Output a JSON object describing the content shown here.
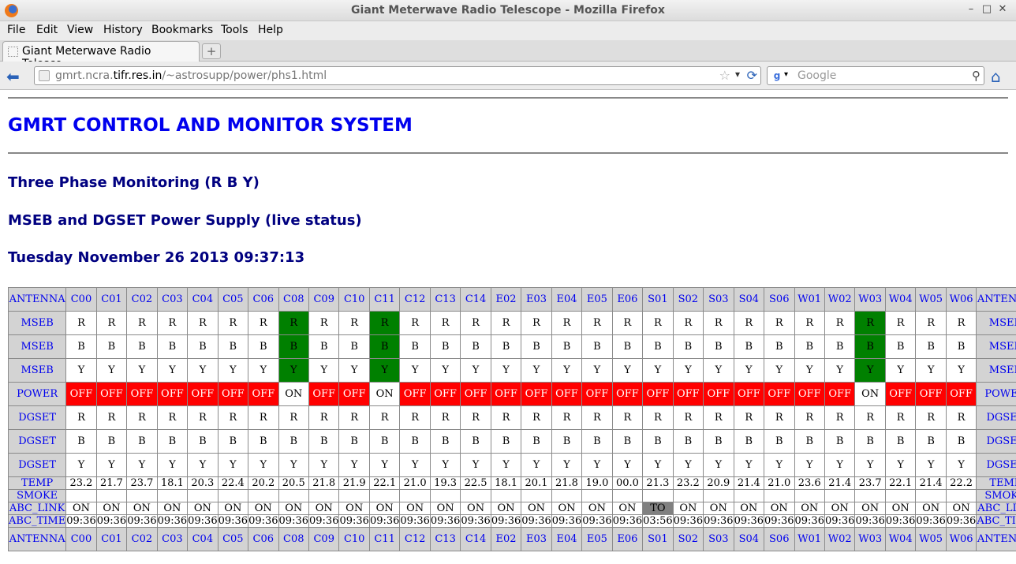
{
  "window": {
    "title": "Giant Meterwave Radio Telescope - Mozilla Firefox"
  },
  "menu": [
    "File",
    "Edit",
    "View",
    "History",
    "Bookmarks",
    "Tools",
    "Help"
  ],
  "tab": {
    "label": "Giant Meterwave Radio Telesco..."
  },
  "urlbar": {
    "prefix": "gmrt.ncra.",
    "domain": "tifr.res.in",
    "path": "/~astrosupp/power/phs1.html"
  },
  "search": {
    "placeholder": "Google",
    "engine_glyph": "g"
  },
  "page": {
    "heading": "GMRT CONTROL AND MONITOR SYSTEM",
    "subheading1": "Three Phase Monitoring (R B Y)",
    "subheading2": "MSEB and DGSET Power Supply (live status)",
    "datetime": "Tuesday November 26 2013 09:37:13"
  },
  "colors": {
    "normal": "#ffffff",
    "alarm": "#ff0000",
    "ok_green": "#008000",
    "timeout": "#808080",
    "header_bg": "#d3d3d3",
    "link": "#0000ee"
  },
  "table": {
    "antennas": [
      "C00",
      "C01",
      "C02",
      "C03",
      "C04",
      "C05",
      "C06",
      "C08",
      "C09",
      "C10",
      "C11",
      "C12",
      "C13",
      "C14",
      "E02",
      "E03",
      "E04",
      "E05",
      "E06",
      "S01",
      "S02",
      "S03",
      "S04",
      "S06",
      "W01",
      "W02",
      "W03",
      "W04",
      "W05",
      "W06"
    ],
    "labels": {
      "antenna": "ANTENNA",
      "mseb": "MSEB",
      "power": "POWER",
      "dgset": "DGSET",
      "temp": "TEMP",
      "smoke": "SMOKE",
      "abc_link": "ABC_LINK",
      "abc_time": "ABC_TIME"
    },
    "mseb_green": [
      "C08",
      "C11",
      "W03"
    ],
    "power": [
      "OFF",
      "OFF",
      "OFF",
      "OFF",
      "OFF",
      "OFF",
      "OFF",
      "ON",
      "OFF",
      "OFF",
      "ON",
      "OFF",
      "OFF",
      "OFF",
      "OFF",
      "OFF",
      "OFF",
      "OFF",
      "OFF",
      "OFF",
      "OFF",
      "OFF",
      "OFF",
      "OFF",
      "OFF",
      "OFF",
      "ON",
      "OFF",
      "OFF",
      "OFF"
    ],
    "phases": [
      "R",
      "B",
      "Y"
    ],
    "temp": [
      "23.2",
      "21.7",
      "23.7",
      "18.1",
      "20.3",
      "22.4",
      "20.2",
      "20.5",
      "21.8",
      "21.9",
      "22.1",
      "21.0",
      "19.3",
      "22.5",
      "18.1",
      "20.1",
      "21.8",
      "19.0",
      "00.0",
      "21.3",
      "23.2",
      "20.9",
      "21.4",
      "21.0",
      "23.6",
      "21.4",
      "23.7",
      "22.1",
      "21.4",
      "22.2"
    ],
    "smoke": [
      "",
      "",
      "",
      "",
      "",
      "",
      "",
      "",
      "",
      "",
      "",
      "",
      "",
      "",
      "",
      "",
      "",
      "",
      "",
      "",
      "",
      "",
      "",
      "",
      "",
      "",
      "",
      "",
      "",
      ""
    ],
    "abc_link": [
      "ON",
      "ON",
      "ON",
      "ON",
      "ON",
      "ON",
      "ON",
      "ON",
      "ON",
      "ON",
      "ON",
      "ON",
      "ON",
      "ON",
      "ON",
      "ON",
      "ON",
      "ON",
      "ON",
      "TO",
      "ON",
      "ON",
      "ON",
      "ON",
      "ON",
      "ON",
      "ON",
      "ON",
      "ON",
      "ON"
    ],
    "abc_time": [
      "09:36",
      "09:36",
      "09:36",
      "09:36",
      "09:36",
      "09:36",
      "09:36",
      "09:36",
      "09:36",
      "09:36",
      "09:36",
      "09:36",
      "09:36",
      "09:36",
      "09:36",
      "09:36",
      "09:36",
      "09:36",
      "09:36",
      "03:56",
      "09:36",
      "09:36",
      "09:36",
      "09:36",
      "09:36",
      "09:36",
      "09:36",
      "09:36",
      "09:36",
      "09:36"
    ]
  }
}
